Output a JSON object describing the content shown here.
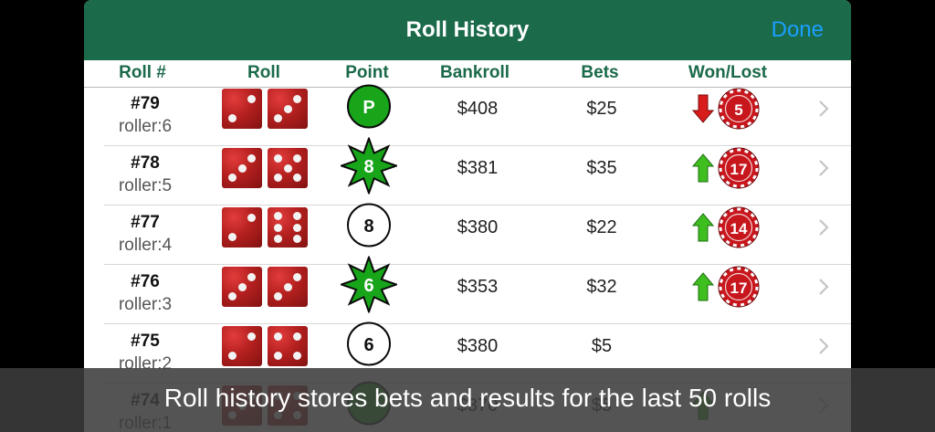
{
  "header": {
    "title": "Roll History",
    "done_label": "Done"
  },
  "columns": {
    "roll_no": "Roll #",
    "roll": "Roll",
    "point": "Point",
    "bankroll": "Bankroll",
    "bets": "Bets",
    "won_lost": "Won/Lost"
  },
  "rows": [
    {
      "roll_no": "#79",
      "roller": "roller:6",
      "dice": [
        2,
        3
      ],
      "point": "P",
      "point_style": "green-circle",
      "bankroll": "$408",
      "bets": "$25",
      "result": "down",
      "chip": "5"
    },
    {
      "roll_no": "#78",
      "roller": "roller:5",
      "dice": [
        3,
        5
      ],
      "point": "8",
      "point_style": "green-star",
      "bankroll": "$381",
      "bets": "$35",
      "result": "up",
      "chip": "17"
    },
    {
      "roll_no": "#77",
      "roller": "roller:4",
      "dice": [
        2,
        6
      ],
      "point": "8",
      "point_style": "white-circle",
      "bankroll": "$380",
      "bets": "$22",
      "result": "up",
      "chip": "14"
    },
    {
      "roll_no": "#76",
      "roller": "roller:3",
      "dice": [
        3,
        3
      ],
      "point": "6",
      "point_style": "green-star",
      "bankroll": "$353",
      "bets": "$32",
      "result": "up",
      "chip": "17"
    },
    {
      "roll_no": "#75",
      "roller": "roller:2",
      "dice": [
        2,
        4
      ],
      "point": "6",
      "point_style": "white-circle",
      "bankroll": "$380",
      "bets": "$5",
      "result": "none",
      "chip": ""
    },
    {
      "roll_no": "#74",
      "roller": "roller:1",
      "dice": [
        3,
        4
      ],
      "point": "",
      "point_style": "green-circle",
      "bankroll": "$370",
      "bets": "$5",
      "result": "up",
      "chip": ""
    }
  ],
  "caption": "Roll history stores bets and results for the last 50 rolls",
  "colors": {
    "header_bg": "#1b6a4a",
    "done": "#1aa0ff",
    "chip": "#c8161d",
    "up_arrow": "#3fbf1f",
    "down_arrow": "#d81b1b"
  }
}
